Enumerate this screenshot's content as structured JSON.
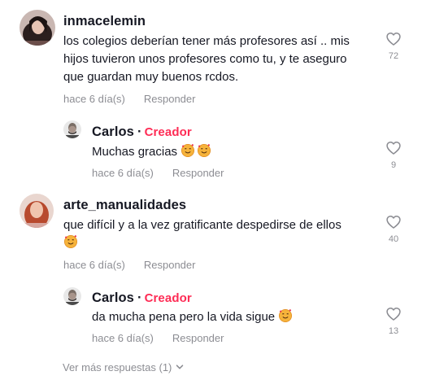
{
  "comments": [
    {
      "username": "inmacelemin",
      "text_line1": "los colegios deberían tener más profesores así .. mis",
      "text_line2": "hijos tuvieron unos profesores como tu, y te aseguro",
      "text_line3": "que guardan muy buenos rcdos.",
      "time": "hace 6 día(s)",
      "reply_label": "Responder",
      "likes": "72",
      "replies": [
        {
          "username": "Carlos",
          "separator": "·",
          "badge": "Creador",
          "text": "Muchas gracias",
          "emojis": [
            "smiling-face-with-hearts",
            "smiling-face-with-hearts"
          ],
          "time": "hace 6 día(s)",
          "reply_label": "Responder",
          "likes": "9"
        }
      ]
    },
    {
      "username": "arte_manualidades",
      "text_line1": "que difícil y a la vez gratificante despedirse de ellos",
      "emojis": [
        "smiling-face-with-hearts"
      ],
      "time": "hace 6 día(s)",
      "reply_label": "Responder",
      "likes": "40",
      "replies": [
        {
          "username": "Carlos",
          "separator": "·",
          "badge": "Creador",
          "text": "da mucha pena pero la vida sigue",
          "emojis": [
            "smiling-face-with-hearts"
          ],
          "time": "hace 6 día(s)",
          "reply_label": "Responder",
          "likes": "13"
        }
      ]
    }
  ],
  "view_more_label": "Ver más respuestas (1)",
  "colors": {
    "creator": "#fe2c55",
    "secondary_text": "#8a8b91",
    "primary_text": "#161823"
  }
}
